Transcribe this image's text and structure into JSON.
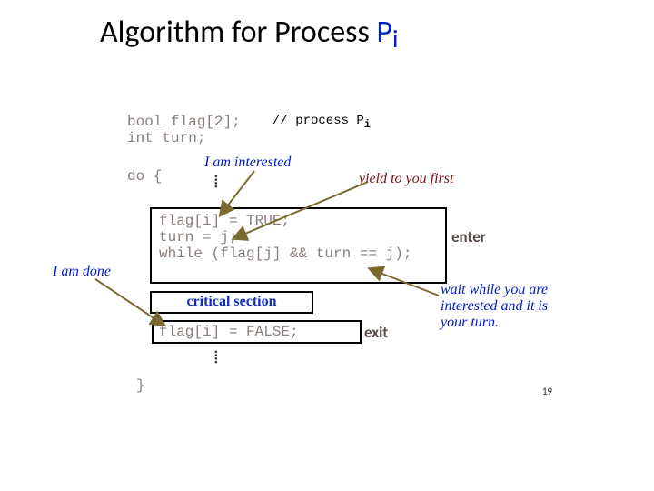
{
  "title": {
    "text": "Algorithm for Process ",
    "p": "P",
    "sub": "i"
  },
  "code": {
    "l1": "bool flag[2];",
    "l2": "int  turn;",
    "l3": "do {",
    "l4": "flag[i] = TRUE;",
    "l5": "turn = j;",
    "l6": "while (flag[j] && turn == j);",
    "l7": "critical section",
    "l8": "flag[i] = FALSE;",
    "l9": "}"
  },
  "comment": "// process P",
  "comment_sub": "i",
  "labels": {
    "enter": "enter",
    "exit": "exit"
  },
  "annotations": {
    "interested": "I am interested",
    "yield": "yield to you first",
    "wait1": "wait while you are",
    "wait2": "interested and it is",
    "wait3": "your turn.",
    "done": "I am done"
  },
  "pagenum": "19"
}
